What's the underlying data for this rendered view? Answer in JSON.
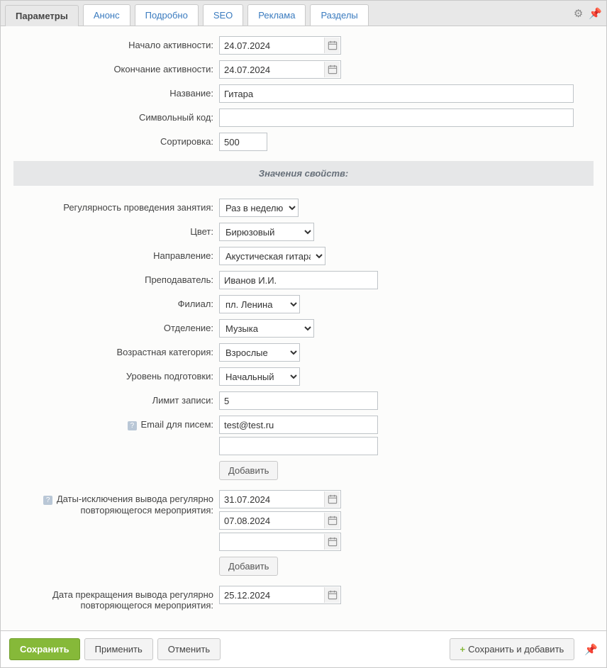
{
  "tabs": {
    "params": "Параметры",
    "anons": "Анонс",
    "detail": "Подробно",
    "seo": "SEO",
    "ad": "Реклама",
    "sections": "Разделы"
  },
  "labels": {
    "active_from": "Начало активности:",
    "active_to": "Окончание активности:",
    "name": "Название:",
    "code": "Символьный код:",
    "sort": "Сортировка:",
    "props_header": "Значения свойств:",
    "regularity": "Регулярность проведения занятия:",
    "color": "Цвет:",
    "direction": "Направление:",
    "teacher": "Преподаватель:",
    "branch": "Филиал:",
    "department": "Отделение:",
    "age": "Возрастная категория:",
    "level": "Уровень подготовки:",
    "limit": "Лимит записи:",
    "email": "Email для писем:",
    "excl_dates": "Даты-исключения вывода регулярно повторяющегося мероприятия:",
    "end_date": "Дата прекращения вывода регулярно повторяющегося мероприятия:",
    "add": "Добавить"
  },
  "values": {
    "active_from": "24.07.2024",
    "active_to": "24.07.2024",
    "name": "Гитара",
    "code": "",
    "sort": "500",
    "regularity": "Раз в неделю",
    "color": "Бирюзовый",
    "direction": "Акустическая гитара",
    "teacher": "Иванов И.И.",
    "branch": "пл. Ленина",
    "department": "Музыка",
    "age": "Взрослые",
    "level": "Начальный",
    "limit": "5",
    "email1": "test@test.ru",
    "email2": "",
    "excl1": "31.07.2024",
    "excl2": "07.08.2024",
    "excl3": "",
    "end_date": "25.12.2024"
  },
  "footer": {
    "save": "Сохранить",
    "apply": "Применить",
    "cancel": "Отменить",
    "save_add": "Сохранить и добавить"
  },
  "icons": {
    "help": "?",
    "plus": "+"
  }
}
